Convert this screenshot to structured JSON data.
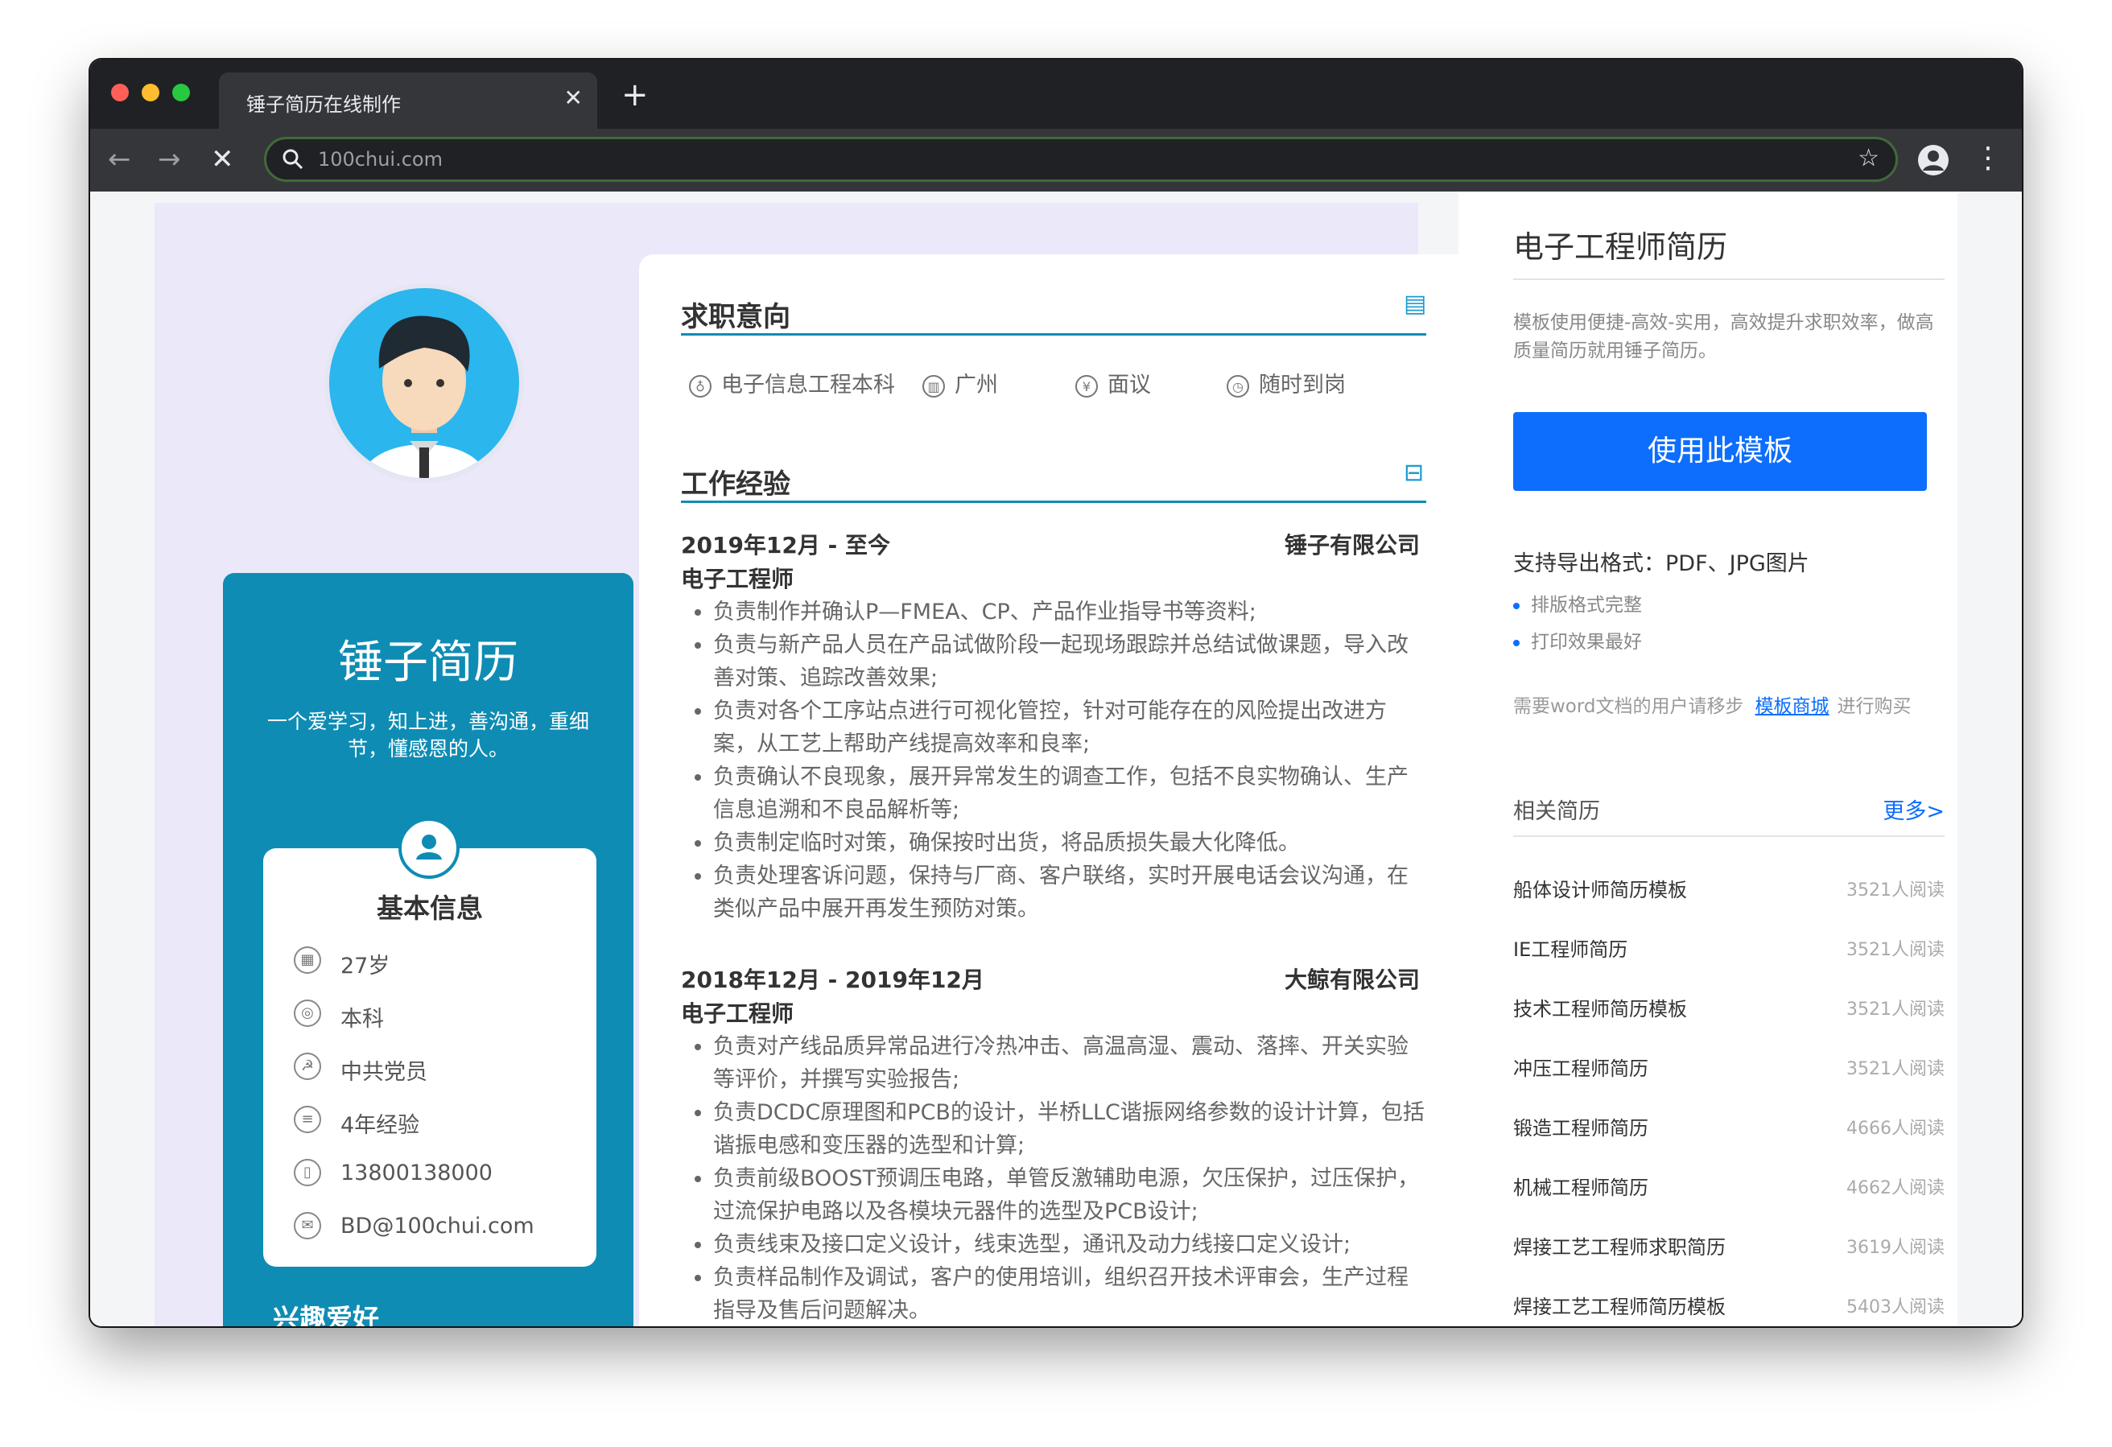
{
  "browser": {
    "tab_title": "锤子简历在线制作",
    "tab_close": "✕",
    "new_tab": "+",
    "url": "100chui.com",
    "back": "←",
    "forward": "→",
    "stop": "✕",
    "star": "☆",
    "menu": "⋮",
    "colors": {
      "red": "#ff5f57",
      "yellow": "#febc2e",
      "green": "#28c840"
    }
  },
  "resume": {
    "name": "锤子简历",
    "motto": "一个爱学习，知上进，善沟通，重细节，懂感恩的人。",
    "basic_info_title": "基本信息",
    "basic_info": [
      "27岁",
      "本科",
      "中共党员",
      "4年经验",
      "13800138000",
      "BD@100chui.com"
    ],
    "bottom_heading": "兴趣爱好",
    "sections": {
      "intent_title": "求职意向",
      "intent": [
        "电子信息工程本科",
        "广州",
        "面议",
        "随时到岗"
      ],
      "experience_title": "工作经验"
    },
    "jobs": [
      {
        "date": "2019年12月 - 至今",
        "company": "锤子有限公司",
        "title": "电子工程师",
        "bullets": [
          "负责制作并确认P—FMEA、CP、产品作业指导书等资料;",
          "负责与新产品人员在产品试做阶段一起现场跟踪并总结试做课题，导入改善对策、追踪改善效果;",
          "负责对各个工序站点进行可视化管控，针对可能存在的风险提出改进方案，从工艺上帮助产线提高效率和良率;",
          "负责确认不良现象，展开异常发生的调查工作，包括不良实物确认、生产信息追溯和不良品解析等;",
          "负责制定临时对策，确保按时出货，将品质损失最大化降低。",
          "负责处理客诉问题，保持与厂商、客户联络，实时开展电话会议沟通，在类似产品中展开再发生预防对策。"
        ]
      },
      {
        "date": "2018年12月 - 2019年12月",
        "company": "大鲸有限公司",
        "title": "电子工程师",
        "bullets": [
          "负责对产线品质异常品进行冷热冲击、高温高湿、震动、落摔、开关实验等评价，并撰写实验报告;",
          "负责DCDC原理图和PCB的设计，半桥LLC谐振网络参数的设计计算，包括谐振电感和变压器的选型和计算;",
          "负责前级BOOST预调压电路，单管反激辅助电源，欠压保护，过压保护，过流保护电路以及各模块元器件的选型及PCB设计;",
          "负责线束及接口定义设计，线束选型，通讯及动力线接口定义设计;",
          "负责样品制作及调试，客户的使用培训，组织召开技术评审会，生产过程指导及售后问题解决。"
        ]
      }
    ]
  },
  "sidebar": {
    "title": "电子工程师简历",
    "description": "模板使用便捷-高效-实用，高效提升求职效率，做高质量简历就用锤子简历。",
    "use_button": "使用此模板",
    "export_formats": "支持导出格式：PDF、JPG图片",
    "features": [
      "排版格式完整",
      "打印效果最好"
    ],
    "need_word_prefix": "需要word文档的用户请移步",
    "need_word_link": "模板商城",
    "need_word_suffix": "进行购买",
    "related_title": "相关简历",
    "related_more": "更多>",
    "related": [
      {
        "name": "船体设计师简历模板",
        "count": "3521人阅读"
      },
      {
        "name": "IE工程师简历",
        "count": "3521人阅读"
      },
      {
        "name": "技术工程师简历模板",
        "count": "3521人阅读"
      },
      {
        "name": "冲压工程师简历",
        "count": "3521人阅读"
      },
      {
        "name": "锻造工程师简历",
        "count": "4666人阅读"
      },
      {
        "name": "机械工程师简历",
        "count": "4662人阅读"
      },
      {
        "name": "焊接工艺工程师求职简历",
        "count": "3619人阅读"
      },
      {
        "name": "焊接工艺工程师简历模板",
        "count": "5403人阅读"
      }
    ]
  }
}
